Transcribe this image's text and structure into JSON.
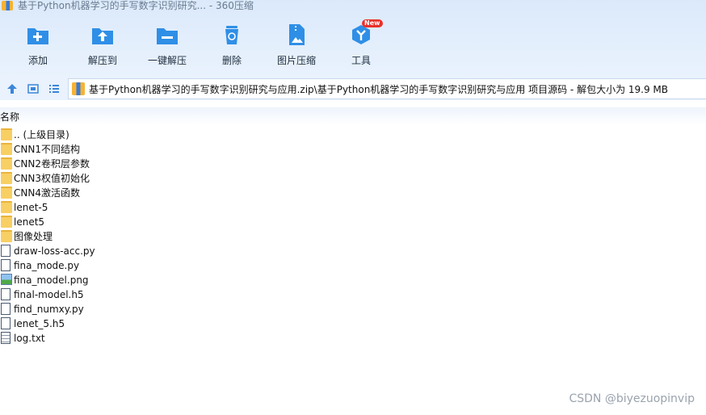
{
  "window": {
    "title": "基于Python机器学习的手写数字识别研究... - 360压缩"
  },
  "toolbar": {
    "items": [
      {
        "label": "添加",
        "icon": "add-icon"
      },
      {
        "label": "解压到",
        "icon": "extract-to-icon"
      },
      {
        "label": "一键解压",
        "icon": "one-click-extract-icon"
      },
      {
        "label": "删除",
        "icon": "delete-icon"
      },
      {
        "label": "图片压缩",
        "icon": "image-compress-icon"
      },
      {
        "label": "工具",
        "icon": "tools-icon"
      }
    ],
    "new_badge": "New"
  },
  "nav": {
    "address": "基于Python机器学习的手写数字识别研究与应用.zip\\基于Python机器学习的手写数字识别研究与应用 项目源码 - 解包大小为 19.9 MB"
  },
  "list": {
    "column_name": "名称",
    "files": [
      {
        "name": ".. (上级目录)",
        "type": "folder"
      },
      {
        "name": "CNN1不同结构",
        "type": "folder"
      },
      {
        "name": "CNN2卷积层参数",
        "type": "folder"
      },
      {
        "name": "CNN3权值初始化",
        "type": "folder"
      },
      {
        "name": "CNN4激活函数",
        "type": "folder"
      },
      {
        "name": "lenet-5",
        "type": "folder"
      },
      {
        "name": "lenet5",
        "type": "folder"
      },
      {
        "name": "图像处理",
        "type": "folder"
      },
      {
        "name": "draw-loss-acc.py",
        "type": "file"
      },
      {
        "name": "fina_mode.py",
        "type": "file"
      },
      {
        "name": "fina_model.png",
        "type": "image"
      },
      {
        "name": "final-model.h5",
        "type": "file"
      },
      {
        "name": "find_numxy.py",
        "type": "file"
      },
      {
        "name": "lenet_5.h5",
        "type": "file"
      },
      {
        "name": "log.txt",
        "type": "text"
      }
    ]
  },
  "watermark": "CSDN @biyezuopinvip",
  "colors": {
    "accent": "#2f8fe6",
    "toolbar_bg": "#dbe9fb",
    "folder": "#f8cf63"
  }
}
